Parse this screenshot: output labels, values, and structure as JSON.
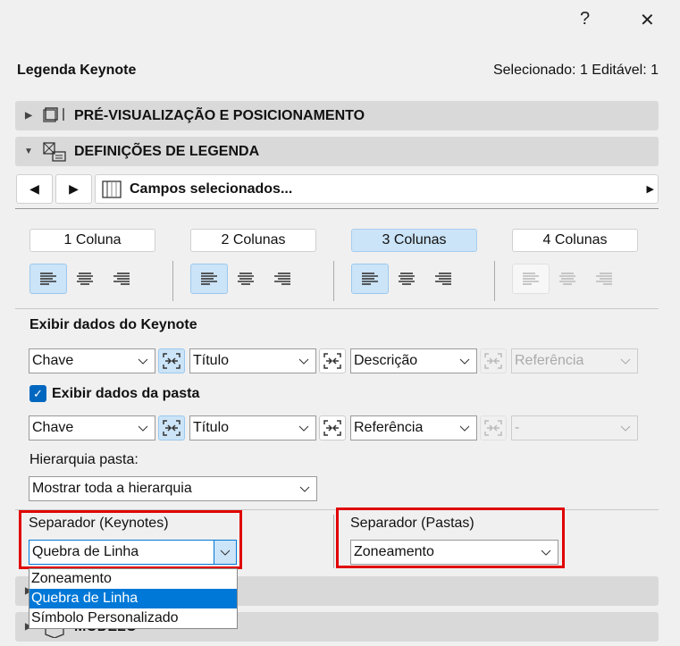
{
  "titlebar": {
    "help": "?",
    "close": "✕"
  },
  "header": {
    "title": "Legenda Keynote",
    "status": "Selecionado: 1 Editável: 1"
  },
  "sections": {
    "preview": "PRÉ-VISUALIZAÇÃO E POSICIONAMENTO",
    "settings": "DEFINIÇÕES DE LEGENDA",
    "model": "MODELO"
  },
  "nav": {
    "fields": "Campos selecionados..."
  },
  "columns": [
    "1 Coluna",
    "2 Colunas",
    "3 Colunas",
    "4 Colunas"
  ],
  "selected_column": "3 Colunas",
  "keynote": {
    "label": "Exibir dados do Keynote",
    "fields": [
      "Chave",
      "Título",
      "Descrição",
      "Referência"
    ]
  },
  "folder": {
    "label": "Exibir dados da pasta",
    "checked": true,
    "fields": [
      "Chave",
      "Título",
      "Referência",
      "-"
    ]
  },
  "hierarchy": {
    "label": "Hierarquia pasta:",
    "value": "Mostrar toda a hierarquia"
  },
  "sep_keynotes": {
    "label": "Separador (Keynotes)",
    "value": "Quebra de Linha",
    "options": [
      "Zoneamento",
      "Quebra de Linha",
      "Símbolo Personalizado"
    ]
  },
  "sep_folders": {
    "label": "Separador (Pastas)",
    "value": "Zoneamento"
  },
  "colors": {
    "accent": "#0078d7",
    "highlight": "#e00000"
  }
}
